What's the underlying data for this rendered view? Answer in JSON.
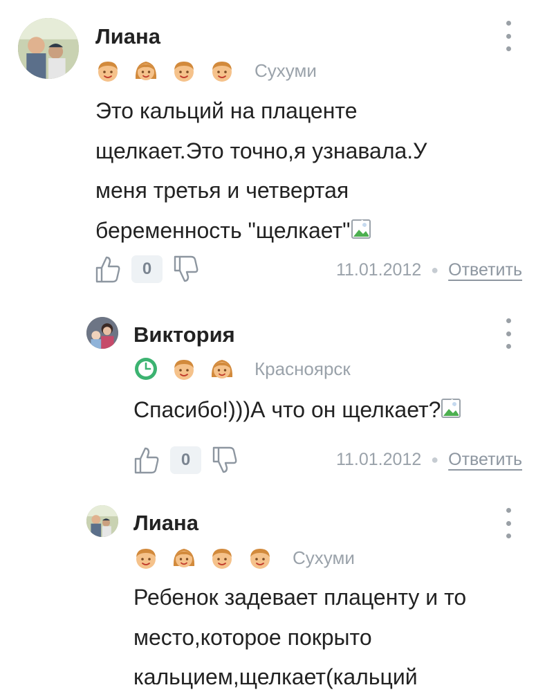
{
  "comments": [
    {
      "author": "Лиана",
      "city": "Сухуми",
      "badges": [
        "boy-badge-icon",
        "girl-badge-icon",
        "boy-badge-icon",
        "boy-badge-icon"
      ],
      "text_lines": [
        "Это кальций на плаценте",
        "щелкает.Это точно,я узнавала.У",
        "меня третья и четвертая",
        "беременность \"щелкает\""
      ],
      "likes": "0",
      "date": "11.01.2012",
      "reply_label": "Ответить"
    },
    {
      "author": "Виктория",
      "city": "Красноярск",
      "badges": [
        "clock-badge-icon",
        "boy-badge-icon",
        "girl-badge-icon"
      ],
      "text_lines": [
        "Спасибо!)))А что он щелкает?"
      ],
      "likes": "0",
      "date": "11.01.2012",
      "reply_label": "Ответить"
    },
    {
      "author": "Лиана",
      "city": "Сухуми",
      "badges": [
        "boy-badge-icon",
        "girl-badge-icon",
        "boy-badge-icon",
        "boy-badge-icon"
      ],
      "text_lines": [
        "Ребенок задевает плаценту и то",
        "место,которое покрыто",
        "кальцием,щелкает(кальций"
      ]
    }
  ],
  "colors": {
    "badge_skin": "#f5c28b",
    "badge_hair": "#d28a3c",
    "clock_green": "#3cb371",
    "meta_grey": "#9aa2aa"
  }
}
